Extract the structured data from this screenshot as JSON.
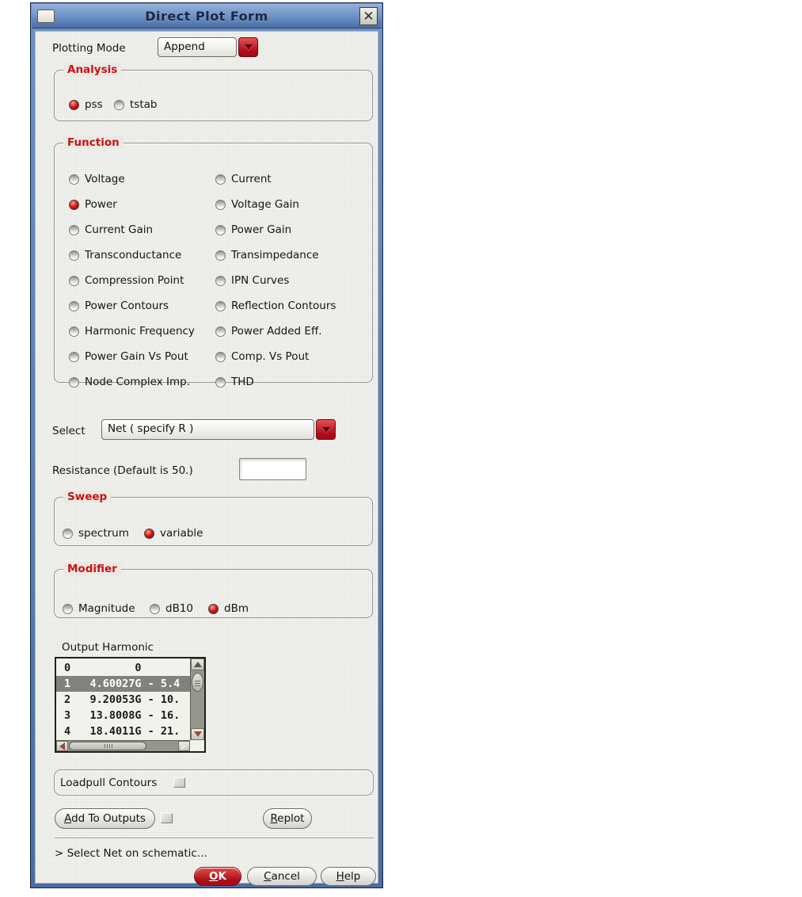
{
  "window": {
    "title": "Direct Plot Form",
    "close_icon": "✕"
  },
  "plotting_mode": {
    "label": "Plotting Mode",
    "value": "Append"
  },
  "analysis": {
    "title": "Analysis",
    "options": [
      {
        "label": "pss",
        "selected": true
      },
      {
        "label": "tstab",
        "selected": false
      }
    ]
  },
  "function": {
    "title": "Function",
    "options": [
      {
        "label": "Voltage",
        "selected": false
      },
      {
        "label": "Current",
        "selected": false
      },
      {
        "label": "Power",
        "selected": true
      },
      {
        "label": "Voltage Gain",
        "selected": false
      },
      {
        "label": "Current Gain",
        "selected": false
      },
      {
        "label": "Power Gain",
        "selected": false
      },
      {
        "label": "Transconductance",
        "selected": false
      },
      {
        "label": "Transimpedance",
        "selected": false
      },
      {
        "label": "Compression Point",
        "selected": false
      },
      {
        "label": "IPN Curves",
        "selected": false
      },
      {
        "label": "Power Contours",
        "selected": false
      },
      {
        "label": "Reflection Contours",
        "selected": false
      },
      {
        "label": "Harmonic Frequency",
        "selected": false
      },
      {
        "label": "Power Added Eff.",
        "selected": false
      },
      {
        "label": "Power Gain Vs Pout",
        "selected": false
      },
      {
        "label": "Comp. Vs Pout",
        "selected": false
      },
      {
        "label": "Node Complex Imp.",
        "selected": false
      },
      {
        "label": "THD",
        "selected": false
      }
    ]
  },
  "select_row": {
    "label": "Select",
    "value": "Net ( specify R )"
  },
  "resistance": {
    "label": "Resistance (Default is 50.)",
    "value": ""
  },
  "sweep": {
    "title": "Sweep",
    "options": [
      {
        "label": "spectrum",
        "selected": false
      },
      {
        "label": "variable",
        "selected": true
      }
    ]
  },
  "modifier": {
    "title": "Modifier",
    "options": [
      {
        "label": "Magnitude",
        "selected": false
      },
      {
        "label": "dB10",
        "selected": false
      },
      {
        "label": "dBm",
        "selected": true
      }
    ]
  },
  "output_harmonic": {
    "label": "Output Harmonic",
    "rows": [
      {
        "text": "0          0",
        "selected": false
      },
      {
        "text": "1   4.60027G - 5.4",
        "selected": true
      },
      {
        "text": "2   9.20053G - 10.",
        "selected": false
      },
      {
        "text": "3   13.8008G - 16.",
        "selected": false
      },
      {
        "text": "4   18.4011G - 21.",
        "selected": false
      }
    ]
  },
  "loadpull": {
    "label": "Loadpull Contours",
    "checked": false
  },
  "actions": {
    "add_to_outputs": "Add To Outputs",
    "add_to_outputs_checked": false,
    "replot": "Replot"
  },
  "status": "> Select Net on schematic...",
  "footer": {
    "ok": "OK",
    "cancel": "Cancel",
    "help": "Help"
  },
  "colors": {
    "accent_red": "#b30d1c",
    "group_title_red": "#cc1111",
    "titlebar_top": "#96b0da",
    "titlebar_bottom": "#4a6da4",
    "selected_row_bg": "#82827d"
  }
}
